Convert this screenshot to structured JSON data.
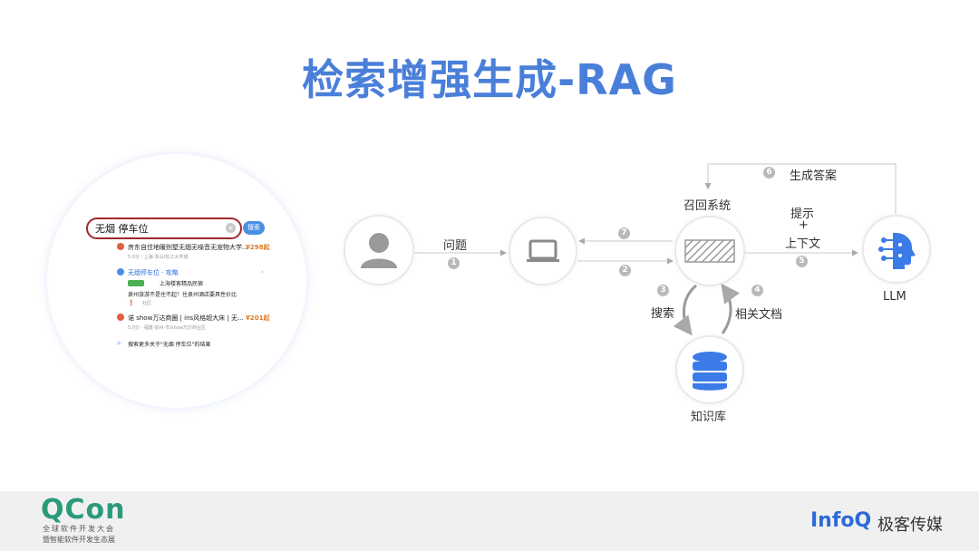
{
  "title": "检索增强生成-RAG",
  "search_panel": {
    "query": "无烟 停车位",
    "search_button": "搜索",
    "results": [
      {
        "title": "房东自住地暖别墅无烟无噪音无宠物大学...",
        "price": "¥298起",
        "meta": "5.0分 · 上海-浙山/松江大学城"
      },
      {
        "title": "无烟停车位 · 攻略",
        "tag": "上海楼客精品民宿",
        "extra": "泉州旅游不是住不起！住泉州酒店要具性价比❗",
        "extra_tag": "社区"
      },
      {
        "title": "诺 show万达商圈 | ins风格超大床 | 无...",
        "price": "¥201起",
        "meta": "5.0分 · 福建-泉州-市/show万达商业区"
      }
    ],
    "more": "搜索更多关于\"无烟 停车位\"的结果"
  },
  "diagram": {
    "labels": {
      "question": "问题",
      "recall": "召回系统",
      "hint1": "提示",
      "hint2": "+",
      "hint3": "上下文",
      "generate": "生成答案",
      "search": "搜索",
      "docs": "相关文档",
      "kb": "知识库",
      "llm": "LLM"
    },
    "steps": [
      "1",
      "2",
      "3",
      "4",
      "5",
      "6",
      "7"
    ]
  },
  "footer": {
    "qcon": "QCon",
    "qcon_sub1": "全球软件开发大会",
    "qcon_sub2": "暨智能软件开发生态展",
    "infoq": "InfoQ",
    "geek": "极客传媒"
  },
  "colors": {
    "title": "#4a7fd9",
    "accent": "#3b7be8",
    "highlight": "#a0292b"
  }
}
